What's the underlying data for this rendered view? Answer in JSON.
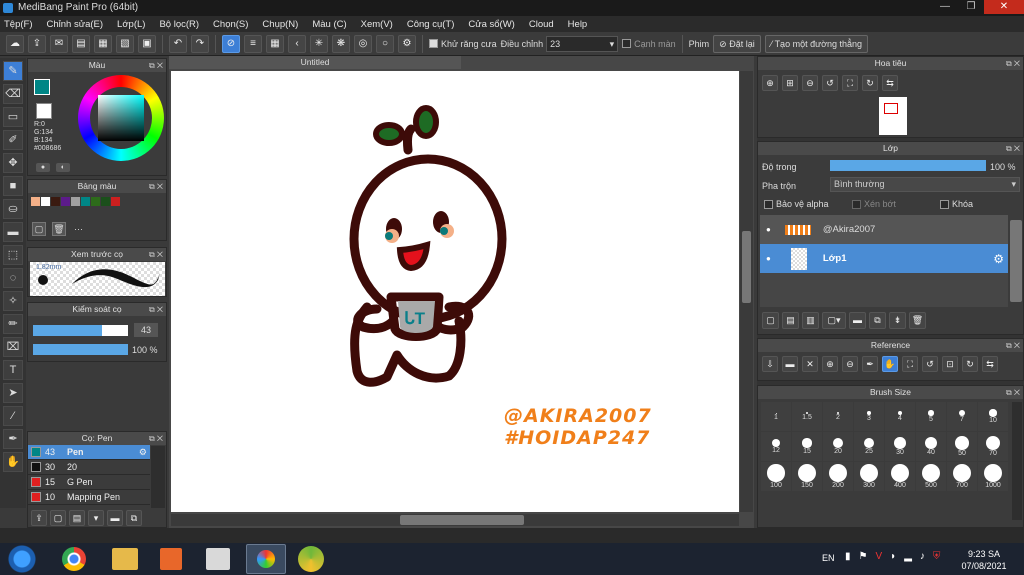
{
  "window": {
    "title": "MediBang Paint Pro (64bit)",
    "min": "—",
    "max": "❐",
    "close": "✕"
  },
  "menu": [
    "Tệp(F)",
    "Chỉnh sửa(E)",
    "Lớp(L)",
    "Bộ lọc(R)",
    "Chọn(S)",
    "Chụp(N)",
    "Màu (C)",
    "Xem(V)",
    "Công cụ(T)",
    "Cửa sổ(W)",
    "Cloud",
    "Help"
  ],
  "toolbar": {
    "antialias_label": "Khử răng cưa",
    "adjust_label": "Điều chỉnh",
    "adjust_value": "23",
    "edge_label": "Cạnh màn",
    "phim_label": "Phim",
    "reset_label": "Đặt lại",
    "straight_line_label": "Tạo một đường thẳng"
  },
  "color_panel": {
    "title": "Màu",
    "r": "R:0",
    "g": "G:134",
    "b": "B:134",
    "hex": "#008686",
    "fg_color": "#008686"
  },
  "palette_panel": {
    "title": "Bảng màu",
    "colors": [
      "#f4b088",
      "#ffffff",
      "#3a1a10",
      "#5c1b8a",
      "#a0a0a0",
      "#008686",
      "#2d6b1a",
      "#1b4f1b",
      "#cc1f1f"
    ],
    "more": "···"
  },
  "brush_preview": {
    "title": "Xem trước cọ",
    "size_label": "1.82mm"
  },
  "brush_control": {
    "title": "Kiểm soát cọ",
    "size_value": "43",
    "opacity_value": "100 %",
    "size_fraction": 0.73,
    "opacity_fraction": 1.0
  },
  "brush_list": {
    "title": "Cọ: Pen",
    "items": [
      {
        "size": "43",
        "name": "Pen",
        "color": "#008686",
        "selected": true
      },
      {
        "size": "30",
        "name": "20",
        "color": "#111111",
        "selected": false
      },
      {
        "size": "15",
        "name": "G Pen",
        "color": "#e02020",
        "selected": false
      },
      {
        "size": "10",
        "name": "Mapping Pen",
        "color": "#e02020",
        "selected": false
      }
    ]
  },
  "canvas": {
    "tab": "Untitled",
    "signature_line1": "@AKIRA2007",
    "signature_line2": "#HOIDAP247",
    "mug_text": "ᒐT",
    "signature_color": "#f07f1a"
  },
  "navigator": {
    "title": "Hoa tiêu"
  },
  "layer_panel": {
    "title": "Lớp",
    "opacity_label": "Độ trong",
    "opacity_value": "100 %",
    "opacity_fraction": 1.0,
    "blend_label": "Pha trộn",
    "blend_value": "Bình thường",
    "alpha_label": "Bảo vệ alpha",
    "clip_label": "Xén bớt",
    "lock_label": "Khóa",
    "layers": [
      {
        "name": "@Akira2007",
        "selected": false
      },
      {
        "name": "Lớp1",
        "selected": true
      }
    ]
  },
  "reference": {
    "title": "Reference"
  },
  "brush_size": {
    "title": "Brush Size",
    "sizes": [
      "1",
      "1.5",
      "2",
      "3",
      "4",
      "5",
      "7",
      "10",
      "12",
      "15",
      "20",
      "25",
      "30",
      "40",
      "50",
      "70",
      "100",
      "150",
      "200",
      "300",
      "400",
      "500",
      "700",
      "1000"
    ]
  },
  "taskbar": {
    "lang": "EN",
    "time": "9:23 SA",
    "date": "07/08/2021"
  }
}
